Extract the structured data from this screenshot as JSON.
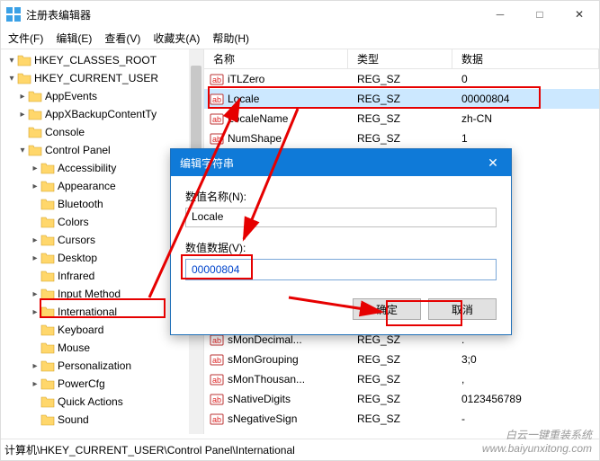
{
  "window": {
    "title": "注册表编辑器"
  },
  "menu": {
    "file": "文件(F)",
    "edit": "编辑(E)",
    "view": "查看(V)",
    "fav": "收藏夹(A)",
    "help": "帮助(H)"
  },
  "tree": [
    {
      "pad": 0,
      "chev": "v",
      "label": "HKEY_CLASSES_ROOT"
    },
    {
      "pad": 0,
      "chev": "v",
      "label": "HKEY_CURRENT_USER"
    },
    {
      "pad": 1,
      "chev": ">",
      "label": "AppEvents"
    },
    {
      "pad": 1,
      "chev": ">",
      "label": "AppXBackupContentTy"
    },
    {
      "pad": 1,
      "chev": "",
      "label": "Console"
    },
    {
      "pad": 1,
      "chev": "v",
      "label": "Control Panel"
    },
    {
      "pad": 2,
      "chev": ">",
      "label": "Accessibility"
    },
    {
      "pad": 2,
      "chev": ">",
      "label": "Appearance"
    },
    {
      "pad": 2,
      "chev": "",
      "label": "Bluetooth"
    },
    {
      "pad": 2,
      "chev": "",
      "label": "Colors"
    },
    {
      "pad": 2,
      "chev": ">",
      "label": "Cursors"
    },
    {
      "pad": 2,
      "chev": ">",
      "label": "Desktop"
    },
    {
      "pad": 2,
      "chev": "",
      "label": "Infrared"
    },
    {
      "pad": 2,
      "chev": ">",
      "label": "Input Method"
    },
    {
      "pad": 2,
      "chev": ">",
      "label": "International",
      "hl": true
    },
    {
      "pad": 2,
      "chev": "",
      "label": "Keyboard"
    },
    {
      "pad": 2,
      "chev": "",
      "label": "Mouse"
    },
    {
      "pad": 2,
      "chev": ">",
      "label": "Personalization"
    },
    {
      "pad": 2,
      "chev": ">",
      "label": "PowerCfg"
    },
    {
      "pad": 2,
      "chev": "",
      "label": "Quick Actions"
    },
    {
      "pad": 2,
      "chev": "",
      "label": "Sound"
    }
  ],
  "cols": {
    "name": "名称",
    "type": "类型",
    "data": "数据"
  },
  "rows": [
    {
      "name": "iTLZero",
      "type": "REG_SZ",
      "data": "0"
    },
    {
      "name": "Locale",
      "type": "REG_SZ",
      "data": "00000804",
      "sel": true,
      "hl": true
    },
    {
      "name": "LocaleName",
      "type": "REG_SZ",
      "data": "zh-CN"
    },
    {
      "name": "NumShape",
      "type": "REG_SZ",
      "data": "1"
    }
  ],
  "rows2": [
    {
      "name": "sMonDecimal...",
      "type": "REG_SZ",
      "data": "."
    },
    {
      "name": "sMonGrouping",
      "type": "REG_SZ",
      "data": "3;0"
    },
    {
      "name": "sMonThousan...",
      "type": "REG_SZ",
      "data": ","
    },
    {
      "name": "sNativeDigits",
      "type": "REG_SZ",
      "data": "0123456789"
    },
    {
      "name": "sNegativeSign",
      "type": "REG_SZ",
      "data": "-"
    }
  ],
  "dialog": {
    "title": "编辑字符串",
    "nameLabel": "数值名称(N):",
    "name": "Locale",
    "valueLabel": "数值数据(V):",
    "value": "00000804",
    "ok": "确定",
    "cancel": "取消"
  },
  "status": "计算机\\HKEY_CURRENT_USER\\Control Panel\\International",
  "watermark": "白云一键重装系统\n    www.baiyunxitong.com"
}
